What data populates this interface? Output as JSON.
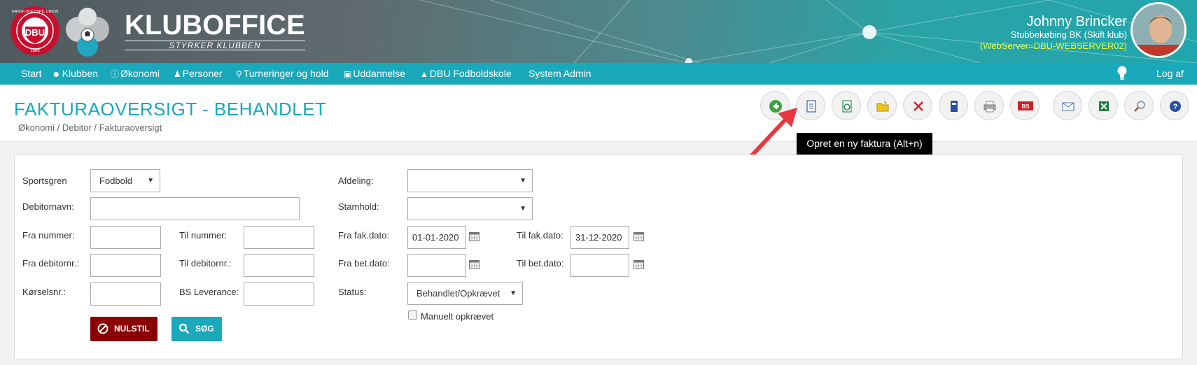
{
  "header": {
    "brand_title": "KLUBOFFICE",
    "brand_tagline": "STYRKER KLUBBEN",
    "user_name": "Johnny Brincker",
    "user_club": "Stubbekøbing BK (Skift klub)",
    "server": "(WebServer=DBU-WEBSERVER02)",
    "logo_text": "DBU",
    "logo_ring_text": "DANSK BOLDSPIL UNION",
    "logo_year": "1889"
  },
  "nav": {
    "items": [
      {
        "label": "Start",
        "icon": ""
      },
      {
        "label": "Klubben",
        "icon": "people-icon"
      },
      {
        "label": "Økonomi",
        "icon": "coin-icon"
      },
      {
        "label": "Personer",
        "icon": "person-icon"
      },
      {
        "label": "Turneringer og hold",
        "icon": "trophy-icon"
      },
      {
        "label": "Uddannelse",
        "icon": "monitor-icon"
      },
      {
        "label": "DBU Fodboldskole",
        "icon": "graduation-cap-icon"
      },
      {
        "label": "System Admin",
        "icon": ""
      }
    ],
    "logout": "Log af"
  },
  "page": {
    "title": "FAKTURAOVERSIGT - BEHANDLET",
    "breadcrumb": "Økonomi / Debitor / Fakturaoversigt"
  },
  "toolbar": {
    "tooltip": "Opret en ny faktura (Alt+n)"
  },
  "filters": {
    "sportsgren_label": "Sportsgren",
    "sportsgren_value": "Fodbold",
    "debitornavn_label": "Debitornavn:",
    "debitornavn_value": "",
    "fra_nummer_label": "Fra nummer:",
    "fra_nummer_value": "",
    "til_nummer_label": "Til nummer:",
    "til_nummer_value": "",
    "fra_debitornr_label": "Fra debitornr.:",
    "fra_debitornr_value": "",
    "til_debitornr_label": "Til debitornr.:",
    "til_debitornr_value": "",
    "korselsnr_label": "Kørselsnr.:",
    "korselsnr_value": "",
    "bs_leverance_label": "BS Leverance:",
    "bs_leverance_value": "",
    "afdeling_label": "Afdeling:",
    "afdeling_value": "",
    "stamhold_label": "Stamhold:",
    "stamhold_value": "",
    "fra_fak_label": "Fra fak.dato:",
    "fra_fak_value": "01-01-2020",
    "til_fak_label": "Til fak.dato:",
    "til_fak_value": "31-12-2020",
    "fra_bet_label": "Fra bet.dato:",
    "fra_bet_value": "",
    "til_bet_label": "Til bet.dato:",
    "til_bet_value": "",
    "status_label": "Status:",
    "status_value": "Behandlet/Opkrævet",
    "manuelt_label": "Manuelt opkrævet",
    "reset_label": "NULSTIL",
    "search_label": "SØG"
  },
  "colors": {
    "accent": "#1aa8bb",
    "reset_button": "#8b0000",
    "search_button": "#1aa8bb",
    "server_text": "#e6ff3a"
  }
}
